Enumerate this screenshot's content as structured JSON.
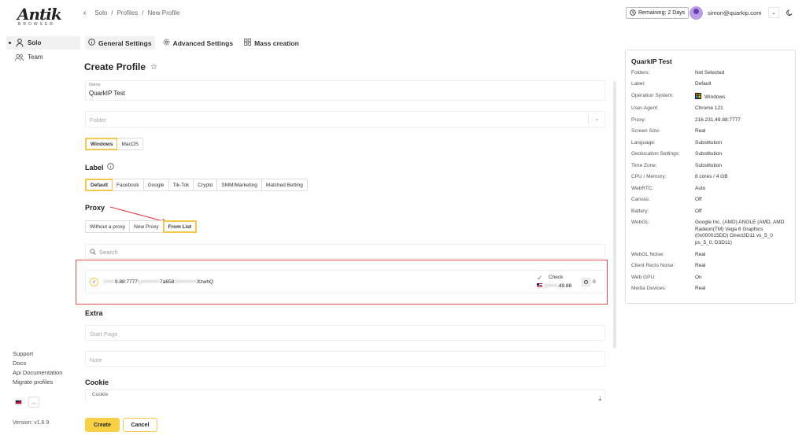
{
  "app": {
    "logo": "Antik",
    "logo_sub": "BROWSER",
    "version": "Version: v1.6.9"
  },
  "sidebar": {
    "items": [
      {
        "label": "Solo",
        "icon": "person-icon",
        "active": true
      },
      {
        "label": "Team",
        "icon": "team-icon",
        "active": false
      }
    ],
    "links": [
      "Support",
      "Docs",
      "Api Documentation",
      "Migrate profiles"
    ]
  },
  "header": {
    "breadcrumb": [
      "Solo",
      "Profiles",
      "New Profile"
    ],
    "remaining": "Remaining: 2 Days",
    "email": "simon@quarkip.com"
  },
  "tabs": [
    {
      "label": "General Settings",
      "icon": "info-icon",
      "active": true
    },
    {
      "label": "Advanced Settings",
      "icon": "gear-icon",
      "active": false
    },
    {
      "label": "Mass creation",
      "icon": "grid-icon",
      "active": false
    }
  ],
  "form": {
    "title": "Create Profile",
    "name_label": "Name",
    "name_value": "QuarkIP Test",
    "folder_placeholder": "Folder",
    "os_options": [
      "Windows",
      "MacOS"
    ],
    "os_selected": "Windows",
    "label_heading": "Label",
    "label_options": [
      "Default",
      "Facebook",
      "Google",
      "Tik-Tok",
      "Crypto",
      "SMM/Marketing",
      "Matched Betting"
    ],
    "label_selected": "Default",
    "proxy_heading": "Proxy",
    "proxy_options": [
      "Without a proxy",
      "New Proxy",
      "From List"
    ],
    "proxy_selected": "From List",
    "search_placeholder": "Search",
    "proxy_item": {
      "address_blurred_a": "2•••••",
      "address_visible_a": "9.88:7777:",
      "address_blurred_b": "p••••••••••",
      "address_visible_b": "7a658:",
      "address_blurred_c": "S••••••••••",
      "address_visible_c": "XzwhQ",
      "check_label": "Check",
      "ip_blurred": "2••••••",
      "ip_visible": ".49.88",
      "count": "0"
    },
    "extra_heading": "Extra",
    "start_page_placeholder": "Start Page",
    "note_placeholder": "Note",
    "cookie_heading": "Cookie",
    "cookie_label": "Cookie",
    "create_button": "Create",
    "cancel_button": "Cancel"
  },
  "summary": {
    "title": "QuarkIP Test",
    "rows": [
      {
        "k": "Folders:",
        "v": "Not Selected"
      },
      {
        "k": "Label:",
        "v": "Default"
      },
      {
        "k": "Operation System:",
        "v": "Windows"
      },
      {
        "k": "User-Agent:",
        "v": "Chrome 121"
      },
      {
        "k": "Proxy:",
        "v": "216.231.49.88:7777"
      },
      {
        "k": "Screen Size:",
        "v": "Real"
      },
      {
        "k": "Language:",
        "v": "Substitution"
      },
      {
        "k": "Geolocation Settings:",
        "v": "Substitution"
      },
      {
        "k": "Time Zone:",
        "v": "Substitution"
      },
      {
        "k": "CPU / Memory:",
        "v": "8 cores / 4 GB"
      },
      {
        "k": "WebRTC:",
        "v": "Auto"
      },
      {
        "k": "Canvas:",
        "v": "Off"
      },
      {
        "k": "Battery:",
        "v": "Off"
      },
      {
        "k": "WebGL:",
        "v": "Google Inc. (AMD) ANGLE (AMD, AMD Radeon(TM) Vega 6 Graphics (0x000015DD) Direct3D11 vs_5_0 ps_5_0, D3D11)"
      },
      {
        "k": "WebGL Noise:",
        "v": "Real"
      },
      {
        "k": "Client Rects Noise:",
        "v": "Real"
      },
      {
        "k": "Web GPU:",
        "v": "On"
      },
      {
        "k": "Media Devices:",
        "v": "Real"
      }
    ]
  },
  "colors": {
    "accent": "#f7d046",
    "highlight_border": "#e05050",
    "arrow": "#e03030"
  }
}
